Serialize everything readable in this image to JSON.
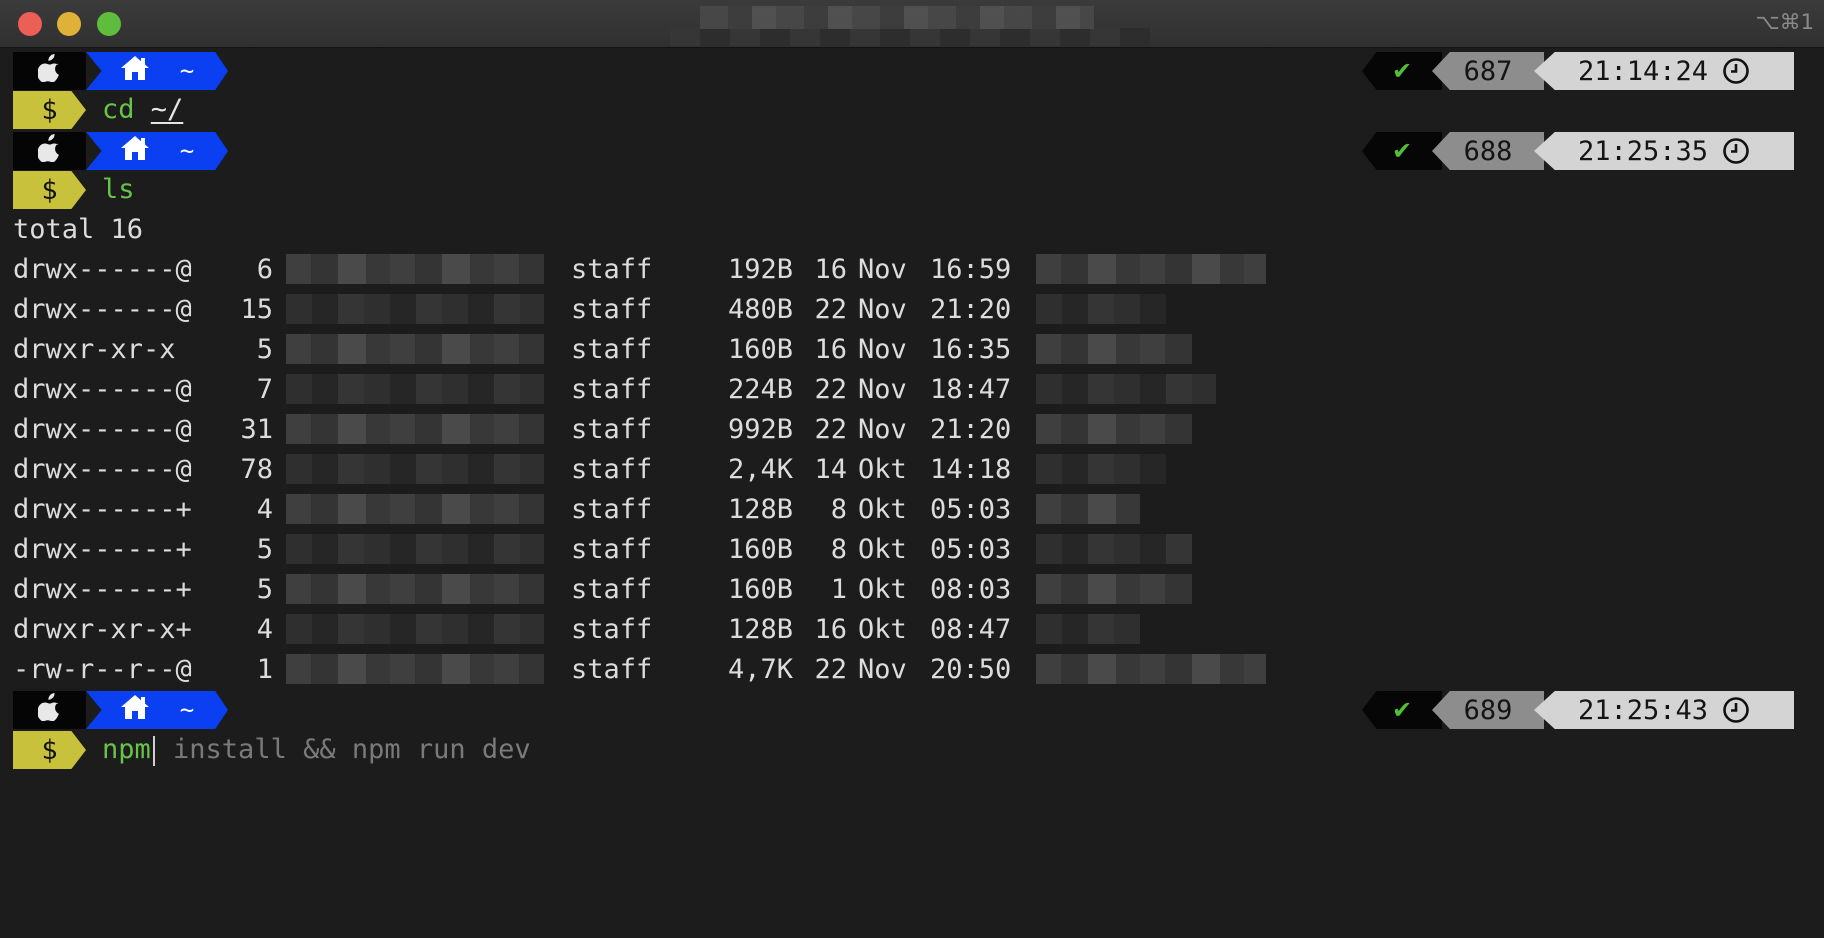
{
  "window": {
    "shortcut": "⌥⌘1"
  },
  "icons": {
    "apple": "apple-icon",
    "home": "home-icon",
    "check": "checkmark-icon",
    "clock": "clock-icon"
  },
  "colors": {
    "background": "#1c1c1c",
    "home_segment": "#0a3ff2",
    "prompt_segment": "#c8c13c",
    "command": "#67c449",
    "check": "#4fc132"
  },
  "prompts": [
    {
      "dir": "~",
      "symbol": "$",
      "command": "cd",
      "argument": "~/",
      "status": "✔",
      "history_number": "687",
      "time": "21:14:24"
    },
    {
      "dir": "~",
      "symbol": "$",
      "command": "ls",
      "argument": "",
      "status": "✔",
      "history_number": "688",
      "time": "21:25:35"
    },
    {
      "dir": "~",
      "symbol": "$",
      "command": "npm",
      "autosuggestion": " install && npm run dev",
      "status": "✔",
      "history_number": "689",
      "time": "21:25:43"
    }
  ],
  "ls_output": {
    "total_line": "total 16",
    "rows": [
      {
        "perms": "drwx------@",
        "links": "6",
        "group": "staff",
        "size": "192B",
        "day": "16",
        "month": "Nov",
        "time": "16:59"
      },
      {
        "perms": "drwx------@",
        "links": "15",
        "group": "staff",
        "size": "480B",
        "day": "22",
        "month": "Nov",
        "time": "21:20"
      },
      {
        "perms": "drwxr-xr-x",
        "links": "5",
        "group": "staff",
        "size": "160B",
        "day": "16",
        "month": "Nov",
        "time": "16:35"
      },
      {
        "perms": "drwx------@",
        "links": "7",
        "group": "staff",
        "size": "224B",
        "day": "22",
        "month": "Nov",
        "time": "18:47"
      },
      {
        "perms": "drwx------@",
        "links": "31",
        "group": "staff",
        "size": "992B",
        "day": "22",
        "month": "Nov",
        "time": "21:20"
      },
      {
        "perms": "drwx------@",
        "links": "78",
        "group": "staff",
        "size": "2,4K",
        "day": "14",
        "month": "Okt",
        "time": "14:18"
      },
      {
        "perms": "drwx------+",
        "links": "4",
        "group": "staff",
        "size": "128B",
        "day": "8",
        "month": "Okt",
        "time": "05:03"
      },
      {
        "perms": "drwx------+",
        "links": "5",
        "group": "staff",
        "size": "160B",
        "day": "8",
        "month": "Okt",
        "time": "05:03"
      },
      {
        "perms": "drwx------+",
        "links": "5",
        "group": "staff",
        "size": "160B",
        "day": "1",
        "month": "Okt",
        "time": "08:03"
      },
      {
        "perms": "drwxr-xr-x+",
        "links": "4",
        "group": "staff",
        "size": "128B",
        "day": "16",
        "month": "Okt",
        "time": "08:47"
      },
      {
        "perms": "-rw-r--r--@",
        "links": "1",
        "group": "staff",
        "size": "4,7K",
        "day": "22",
        "month": "Nov",
        "time": "20:50"
      }
    ]
  }
}
